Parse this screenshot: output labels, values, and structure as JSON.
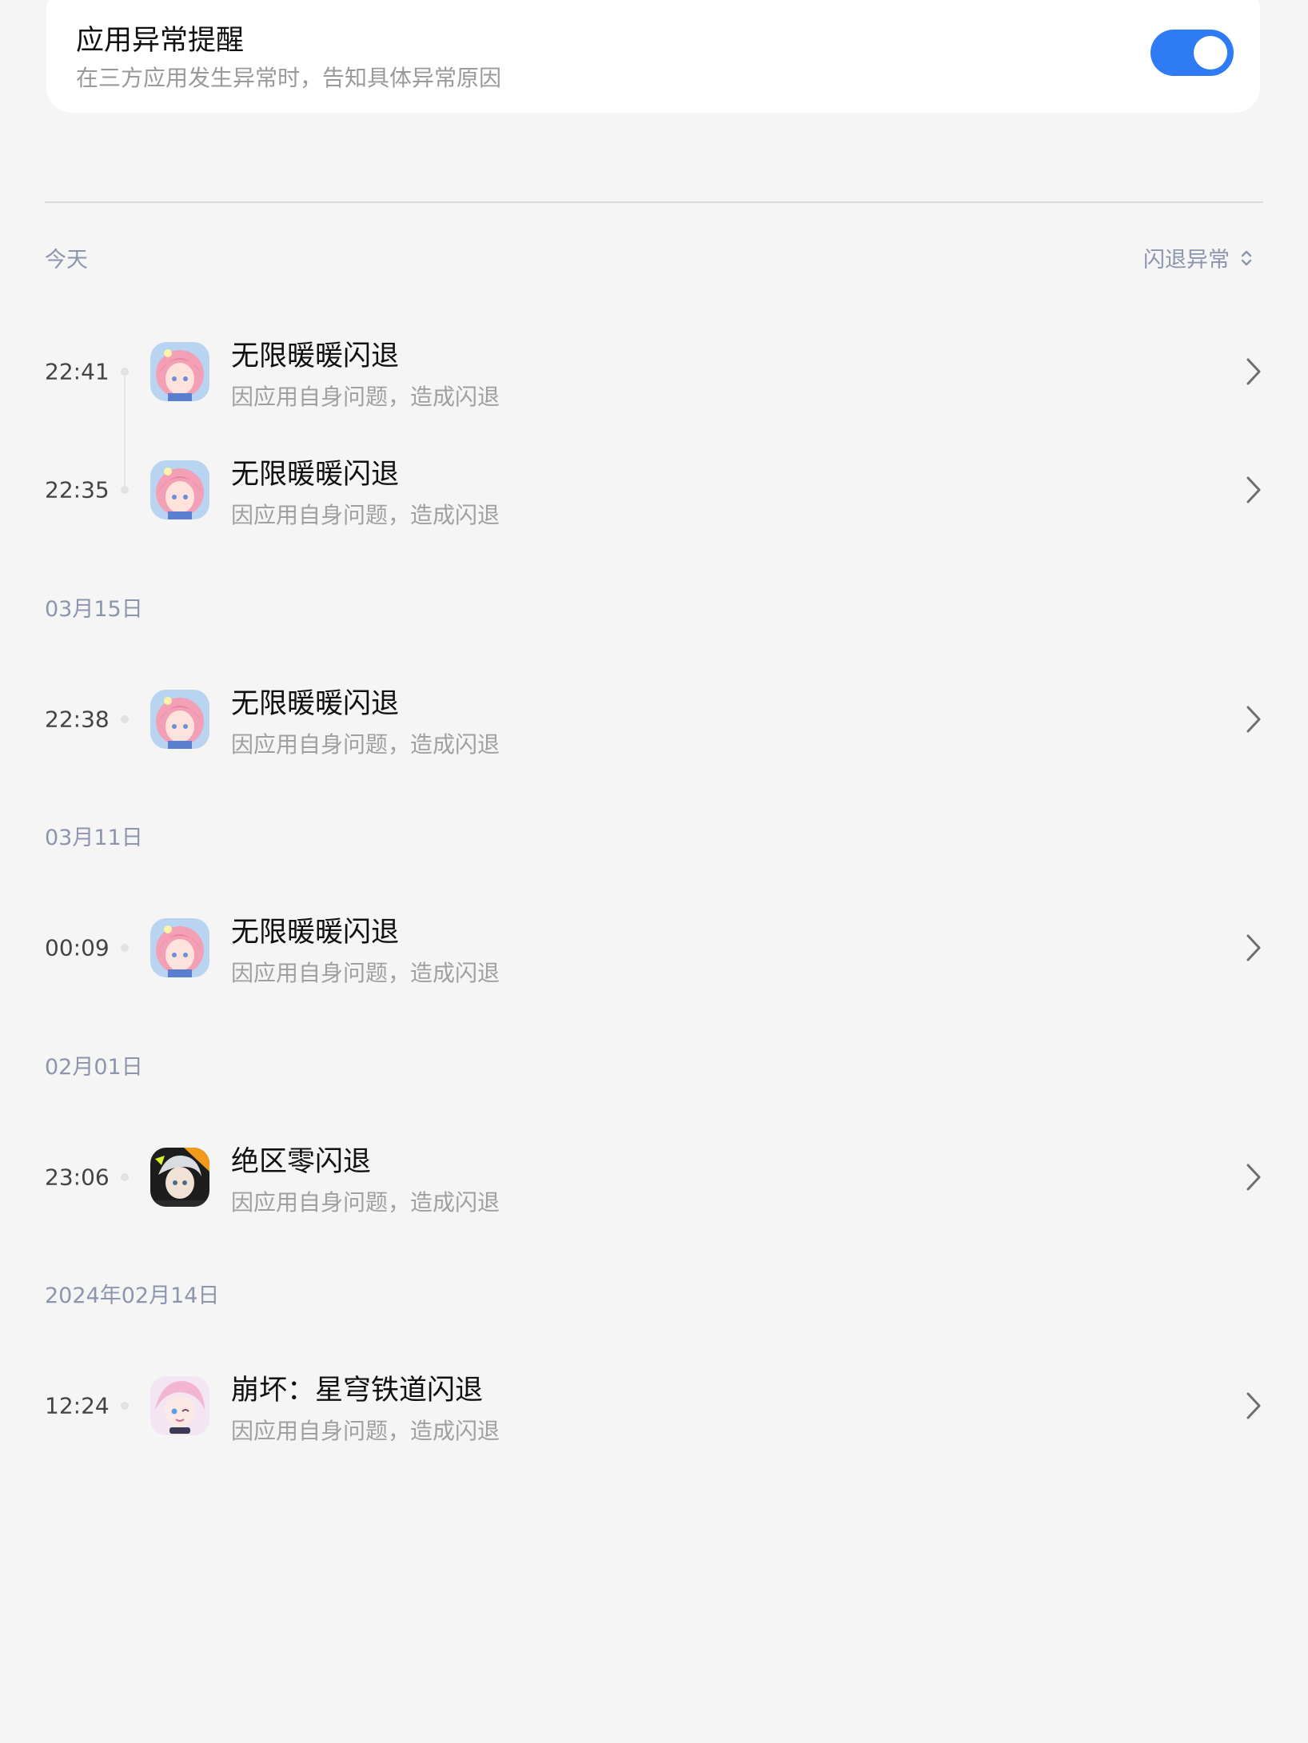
{
  "header_card": {
    "title": "应用异常提醒",
    "subtitle": "在三方应用发生异常时，告知具体异常原因",
    "toggle_on": true
  },
  "filter": {
    "label": "闪退异常"
  },
  "reason_text": "因应用自身问题，造成闪退",
  "groups": [
    {
      "date": "今天",
      "items": [
        {
          "time": "22:41",
          "app": "无限暖暖闪退",
          "icon": "infinity-nikki-app-icon"
        },
        {
          "time": "22:35",
          "app": "无限暖暖闪退",
          "icon": "infinity-nikki-app-icon"
        }
      ]
    },
    {
      "date": "03月15日",
      "items": [
        {
          "time": "22:38",
          "app": "无限暖暖闪退",
          "icon": "infinity-nikki-app-icon"
        }
      ]
    },
    {
      "date": "03月11日",
      "items": [
        {
          "time": "00:09",
          "app": "无限暖暖闪退",
          "icon": "infinity-nikki-app-icon"
        }
      ]
    },
    {
      "date": "02月01日",
      "items": [
        {
          "time": "23:06",
          "app": "绝区零闪退",
          "icon": "zenless-zone-zero-app-icon"
        }
      ]
    },
    {
      "date": "2024年02月14日",
      "items": [
        {
          "time": "12:24",
          "app": "崩坏：星穹铁道闪退",
          "icon": "honkai-star-rail-app-icon"
        }
      ]
    }
  ],
  "colors": {
    "accent": "#2f7bf5",
    "date_label": "#8d95ad",
    "background": "#f5f5f5"
  }
}
